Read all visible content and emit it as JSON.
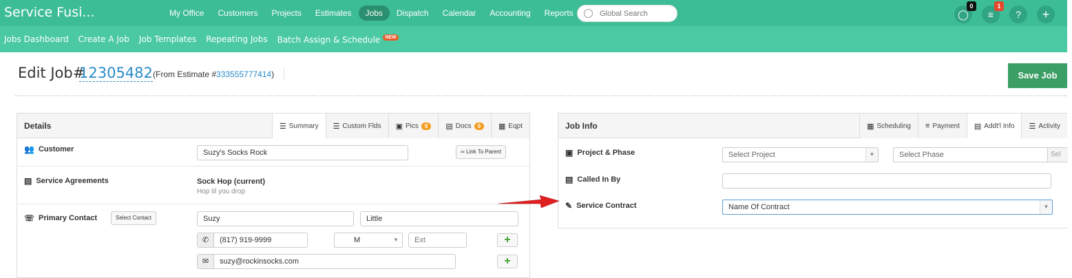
{
  "brand": "Service Fusi...",
  "main_nav": [
    "My Office",
    "Customers",
    "Projects",
    "Estimates",
    "Jobs",
    "Dispatch",
    "Calendar",
    "Accounting",
    "Reports"
  ],
  "search": {
    "placeholder": "Global Search"
  },
  "top_badges": {
    "chat": "0",
    "menu": "1"
  },
  "top_icons": {
    "help": "?",
    "add": "+"
  },
  "sub_nav": [
    "Jobs Dashboard",
    "Create A Job",
    "Job Templates",
    "Repeating Jobs",
    "Batch Assign & Schedule"
  ],
  "new_badge": "NEW",
  "header": {
    "edit_label": "Edit Job#",
    "job_number": "12305482",
    "from_prefix": "(From Estimate #",
    "estimate_number": "333555777414",
    "from_suffix": ")",
    "save_label": "Save Job"
  },
  "details": {
    "title": "Details",
    "tabs": [
      {
        "label": "Summary",
        "icon": "list-icon"
      },
      {
        "label": "Custom Flds",
        "icon": "list-icon"
      },
      {
        "label": "Pics",
        "icon": "camera-icon",
        "count": "0"
      },
      {
        "label": "Docs",
        "icon": "document-icon",
        "count": "0"
      },
      {
        "label": "Eqpt",
        "icon": "equipment-icon"
      }
    ],
    "customer_label": "Customer",
    "customer_value": "Suzy's Socks Rock",
    "link_parent": "Link To Parent",
    "agreements_label": "Service Agreements",
    "agreement_name": "Sock Hop (current)",
    "agreement_desc": "Hop til you drop",
    "contact_label": "Primary Contact",
    "select_contact": "Select Contact",
    "first_name": "Suzy",
    "last_name": "Little",
    "phone": "(817) 919-9999",
    "phone_type": "M",
    "ext_placeholder": "Ext",
    "email": "suzy@rockinsocks.com"
  },
  "jobinfo": {
    "title": "Job Info",
    "tabs": [
      {
        "label": "Scheduling",
        "icon": "calendar-icon"
      },
      {
        "label": "Payment",
        "icon": "payment-icon"
      },
      {
        "label": "Addt'l Info",
        "icon": "clipboard-icon"
      },
      {
        "label": "Activity",
        "icon": "list-icon"
      }
    ],
    "project_label": "Project & Phase",
    "select_project": "Select Project",
    "select_phase": "Select Phase",
    "phase_cut": "Sel",
    "called_label": "Called In By",
    "called_value": "",
    "contract_label": "Service Contract",
    "contract_value": "Name Of Contract"
  },
  "colors": {
    "nav": "#3dbd95",
    "subnav": "#4ac9a2",
    "save": "#3b9e64",
    "link": "#2a8bc7",
    "badge_orange": "#f29d1f",
    "arrow": "#e02020"
  }
}
